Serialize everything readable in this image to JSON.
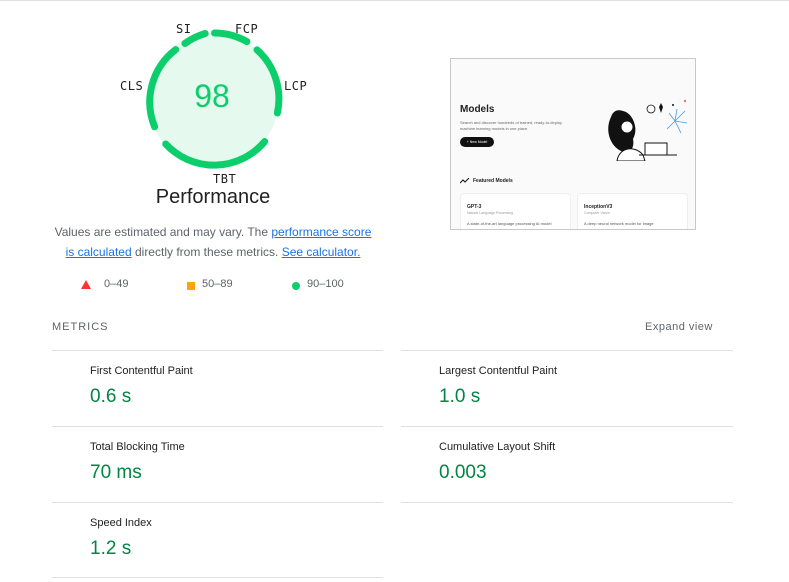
{
  "gauge": {
    "score": "98",
    "labels": {
      "si": "SI",
      "fcp": "FCP",
      "lcp": "LCP",
      "cls": "CLS",
      "tbt": "TBT"
    },
    "color": "#0cce6b"
  },
  "performance_title": "Performance",
  "description": {
    "text1": "Values are estimated and may vary. The ",
    "link1": "performance score is calculated",
    "text2": " directly from these metrics. ",
    "link2": "See calculator."
  },
  "legend": [
    {
      "range": "0–49",
      "color": "#ff3333",
      "shape": "triangle"
    },
    {
      "range": "50–89",
      "color": "#ffa400",
      "shape": "square"
    },
    {
      "range": "90–100",
      "color": "#0cce6b",
      "shape": "circle"
    }
  ],
  "screenshot": {
    "title": "Models",
    "subtitle": "Search and discover hundreds of trained, ready-to-deploy machine learning models in one place.",
    "button": "+ New Model",
    "featured": "Featured Models",
    "cards": [
      {
        "title": "GPT-3",
        "subtitle": "Natural Language Processing",
        "desc": "A state-of-the-art language processing AI model"
      },
      {
        "title": "InceptionV3",
        "subtitle": "Computer Vision",
        "desc": "A deep neural network model for image"
      }
    ]
  },
  "metrics": {
    "heading": "METRICS",
    "expand_label": "Expand view",
    "items": {
      "fcp": {
        "label": "First Contentful Paint",
        "value": "0.6 s"
      },
      "lcp": {
        "label": "Largest Contentful Paint",
        "value": "1.0 s"
      },
      "tbt": {
        "label": "Total Blocking Time",
        "value": "70 ms"
      },
      "cls": {
        "label": "Cumulative Layout Shift",
        "value": "0.003"
      },
      "si": {
        "label": "Speed Index",
        "value": "1.2 s"
      }
    },
    "value_color": "#018642"
  }
}
